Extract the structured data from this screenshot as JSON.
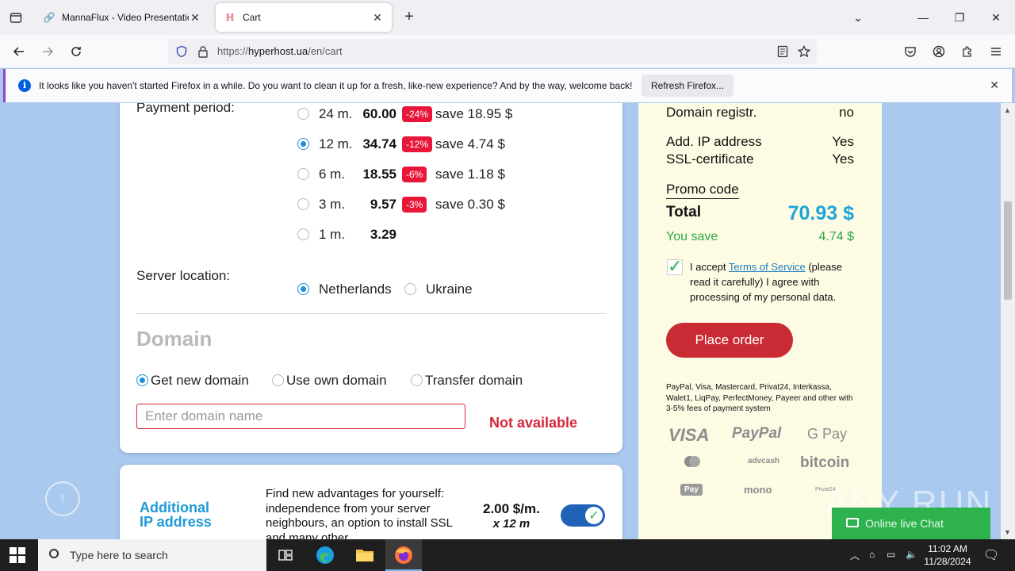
{
  "browser": {
    "tabs": [
      {
        "title": "MannaFlux - Video Presentation",
        "active": false
      },
      {
        "title": "Cart",
        "active": true
      }
    ],
    "url_prefix": "https://",
    "url_host": "hyperhost.ua",
    "url_path": "/en/cart"
  },
  "notification": {
    "message": "It looks like you haven't started Firefox in a while. Do you want to clean it up for a fresh, like-new experience? And by the way, welcome back!",
    "button": "Refresh Firefox..."
  },
  "cart": {
    "payment_period_label": "Payment period:",
    "periods": [
      {
        "months": "24 m.",
        "price": "60.00",
        "discount": "-24%",
        "save": "save 18.95 $",
        "selected": false
      },
      {
        "months": "12 m.",
        "price": "34.74",
        "discount": "-12%",
        "save": "save 4.74 $",
        "selected": true
      },
      {
        "months": "6 m.",
        "price": "18.55",
        "discount": "-6%",
        "save": "save 1.18 $",
        "selected": false
      },
      {
        "months": "3 m.",
        "price": "9.57",
        "discount": "-3%",
        "save": "save 0.30 $",
        "selected": false
      },
      {
        "months": "1 m.",
        "price": "3.29",
        "discount": "",
        "save": "",
        "selected": false
      }
    ],
    "server_location_label": "Server location:",
    "locations": [
      {
        "label": "Netherlands",
        "selected": true
      },
      {
        "label": "Ukraine",
        "selected": false
      }
    ],
    "domain_title": "Domain",
    "domain_options": [
      {
        "label": "Get new domain",
        "selected": true
      },
      {
        "label": "Use own domain",
        "selected": false
      },
      {
        "label": "Transfer domain",
        "selected": false
      }
    ],
    "domain_placeholder": "Enter domain name",
    "domain_status": "Not available"
  },
  "addon": {
    "title_line1": "Additional",
    "title_line2": "IP address",
    "description": "Find new advantages for yourself: independence from your server neighbours, an option to install SSL and many other",
    "price": "2.00 $/m.",
    "period": "x 12 m",
    "enabled": true
  },
  "summary": {
    "rows": [
      {
        "label": "Domain registr.",
        "value": "no"
      },
      {
        "label": "Add. IP address",
        "value": "Yes"
      },
      {
        "label": "SSL-certificate",
        "value": "Yes"
      }
    ],
    "promo_code": "Promo code",
    "total_label": "Total",
    "total_value": "70.93 $",
    "save_label": "You save",
    "save_value": "4.74 $",
    "accept_prefix": "I accept ",
    "accept_link": "Terms of Service",
    "accept_suffix": " (please read it carefully) I agree with processing of my personal data.",
    "place_order": "Place order",
    "payment_note": "PayPal, Visa, Mastercard, Privat24, Interkassa, Walet1, LiqPay, PerfectMoney, Payeer and other with 3-5% fees of payment system",
    "payment_logos": [
      "VISA",
      "PayPal",
      "G Pay",
      "",
      "advcash",
      "bitcoin",
      "Pay",
      "mono",
      "Privat24"
    ]
  },
  "chat": {
    "label": "Online live Chat"
  },
  "watermark": "ANY RUN",
  "taskbar": {
    "search_placeholder": "Type here to search",
    "time": "11:02 AM",
    "date": "11/28/2024"
  },
  "colors": {
    "page_bg": "#a9c9ef",
    "accent_blue": "#1ea5d8",
    "danger": "#d6263a",
    "order_button": "#c92a33",
    "success": "#2ba84a",
    "summary_bg": "#fdfbe4"
  }
}
